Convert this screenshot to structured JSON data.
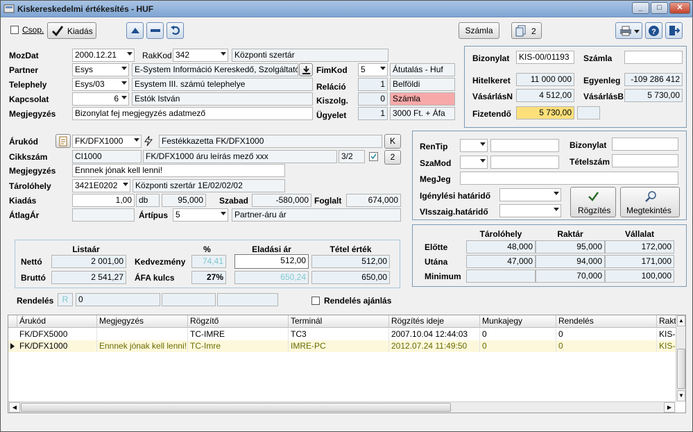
{
  "window": {
    "title": "Kiskereskedelmi értékesítés - HUF"
  },
  "toolbar": {
    "csop_label": "Csop.",
    "kiadas_label": "Kiadás",
    "szamla_label": "Számla",
    "copies_label": "2"
  },
  "header": {
    "mozdat_label": "MozDat",
    "mozdat_value": "2000.12.21",
    "rakkod_label": "RakKod",
    "rakkod_value": "342",
    "rakkod_name": "Központi szertár",
    "partner_label": "Partner",
    "partner_value": "Esys",
    "partner_name": "E-System Információ Kereskedő, Szolgáltató",
    "fimkod_label": "FimKod",
    "fimkod_value": "5",
    "fimkod_name": "Átutalás - Huf",
    "telephely_label": "Telephely",
    "telephely_value": "Esys/03",
    "telephely_name": "Esystem III. számú telephelye",
    "relacio_label": "Reláció",
    "relacio_value": "1",
    "relacio_name": "Belföldi",
    "kapcsolat_label": "Kapcsolat",
    "kapcsolat_value": "6",
    "kapcsolat_name": "Estók István",
    "kiszolg_label": "Kiszolg.",
    "kiszolg_value": "0",
    "kiszolg_name": "Számla",
    "megjegyzes_label": "Megjegyzés",
    "megjegyzes_value": "Bizonylat fej megjegyzés adatmező",
    "ugyelet_label": "Ügyelet",
    "ugyelet_value": "1",
    "ugyelet_name": "3000 Ft. + Áfa"
  },
  "summary": {
    "bizonylat_label": "Bizonylat",
    "bizonylat_value": "KIS-00/01193",
    "szamla_label": "Számla",
    "szamla_value": "",
    "hitelkeret_label": "Hitelkeret",
    "hitelkeret_value": "11 000 000",
    "egyenleg_label": "Egyenleg",
    "egyenleg_value": "-109 286 412",
    "vasarlasn_label": "VásárlásN",
    "vasarlasn_value": "4 512,00",
    "vasarlasb_label": "VásárlásB",
    "vasarlasb_value": "5 730,00",
    "fizetendo_label": "Fizetendő",
    "fizetendo_value": "5 730,00"
  },
  "item": {
    "arukod_label": "Árukód",
    "arukod_value": "FK/DFX1000",
    "arukod_name": "Festékkazetta FK/DFX1000",
    "k_label": "K",
    "cikkszam_label": "Cikkszám",
    "cikkszam_value": "CI1000",
    "cikkszam_desc": "FK/DFX1000 áru leírás mező xxx",
    "cikkszam_ratio": "3/2",
    "count_label": "2",
    "megjegyzes_label": "Megjegyzés",
    "megjegyzes_value": "Ennnek jónak kell lenni!",
    "tarolohely_label": "Tárolóhely",
    "tarolohely_value": "3421E0202",
    "tarolohely_name": "Központi szertár 1E/02/02/02",
    "kiadas_label": "Kiadás",
    "kiadas_value": "1,00",
    "unit": "db",
    "kiadas_price": "95,000",
    "szabad_label": "Szabad",
    "szabad_value": "-580,000",
    "foglalt_label": "Foglalt",
    "foglalt_value": "674,000",
    "atlagar_label": "ÁtlagÁr",
    "atlagar_value": "",
    "artipus_label": "Ártípus",
    "artipus_value": "5",
    "artipus_name": "Partner-áru ár"
  },
  "reserve": {
    "rentip_label": "RenTip",
    "bizonylat_label": "Bizonylat",
    "szamod_label": "SzaMod",
    "tetelszam_label": "Tételszám",
    "megjeg_label": "MegJeg",
    "igenyles_label": "Igénylési határidő",
    "visszaig_label": "VIsszaig.határidő",
    "rogzites_label": "Rögzítés",
    "megtekintes_label": "Megtekintés"
  },
  "stock": {
    "col1": "Tárolóhely",
    "col2": "Raktár",
    "col3": "Vállalat",
    "rows": [
      {
        "label": "Előtte",
        "values": [
          "48,000",
          "95,000",
          "172,000"
        ]
      },
      {
        "label": "Utána",
        "values": [
          "47,000",
          "94,000",
          "171,000"
        ]
      },
      {
        "label": "Minimum",
        "values": [
          "",
          "70,000",
          "100,000"
        ]
      }
    ]
  },
  "pricing": {
    "listaar_header": "Listaár",
    "pct_header": "%",
    "eladasi_header": "Eladási ár",
    "tetel_header": "Tétel érték",
    "netto_label": "Nettó",
    "netto_value": "2 001,00",
    "kedvezmeny_label": "Kedvezmény",
    "kedvezmeny_pct": "74,41",
    "eladasi_netto": "512,00",
    "tetel_netto": "512,00",
    "brutto_label": "Bruttó",
    "brutto_value": "2 541,27",
    "afa_label": "ÁFA kulcs",
    "afa_pct": "27%",
    "eladasi_brutto": "650,24",
    "tetel_brutto": "650,00"
  },
  "order": {
    "rendeles_label": "Rendelés",
    "r_label": "R",
    "rendeles_value": "0",
    "ajanlas_label": "Rendelés ajánlás"
  },
  "grid": {
    "columns": [
      "Árukód",
      "Megjegyzés",
      "Rögzítő",
      "Terminál",
      "Rögzítés ideje",
      "Munkajegy",
      "Rendelés",
      "Rakt"
    ],
    "rows": [
      [
        "FK/DFX5000",
        "",
        "TC-IMRE",
        "TC3",
        "2007.10.04 12:44:03",
        "0",
        "0",
        "KIS-"
      ],
      [
        "FK/DFX1000",
        "Ennnek jónak kell lenni!",
        "TC-Imre",
        "IMRE-PC",
        "2012.07.24 11:49:50",
        "0",
        "0",
        "KIS-"
      ]
    ]
  },
  "colors": {
    "title_bar": "#8fb0d9",
    "fizetendo_bg": "#fde07a",
    "kiszolg_bg": "#f7a9a9",
    "cyan_text": "#7fc7cf"
  }
}
